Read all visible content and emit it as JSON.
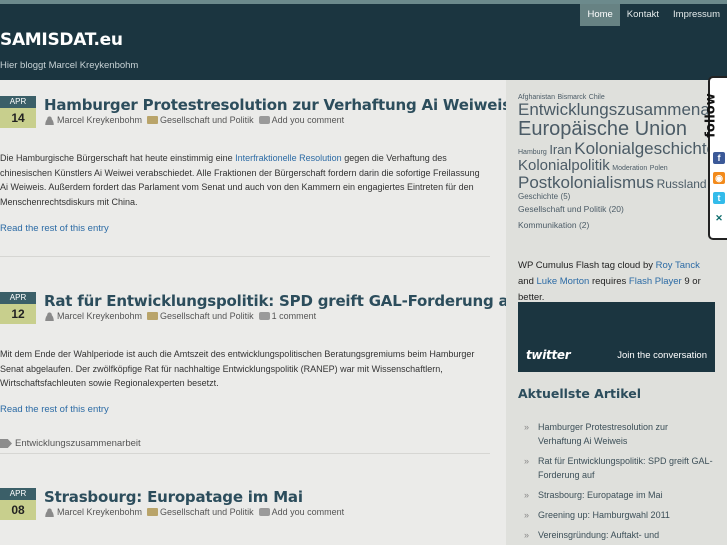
{
  "header": {
    "site_title": "SAMISDAT.eu",
    "site_description": "Hier bloggt Marcel Kreykenbohm",
    "nav": [
      {
        "label": "Home",
        "active": true
      },
      {
        "label": "Kontakt",
        "active": false
      },
      {
        "label": "Impressum",
        "active": false
      }
    ]
  },
  "posts": [
    {
      "month": "Apr",
      "day": "14",
      "title": "Hamburger Protestresolution zur Verhaftung Ai Weiweis",
      "author": "Marcel Kreykenbohm",
      "category": "Gesellschaft und Politik",
      "comments": "Add you comment",
      "excerpt_before": "Die Hamburgische Bürgerschaft hat heute einstimmig eine ",
      "excerpt_link": "Interfraktionelle Resolution",
      "excerpt_after": " gegen die Verhaftung des chinesischen Künstlers Ai Weiwei verabschiedet. Alle Fraktionen der Bürgerschaft fordern darin die sofortige Freilassung Ai Weiweis. Außerdem fordert das Parlament vom Senat und auch von den Kammern ein engagiertes Eintreten für den Menschenrechtsdiskurs mit China.",
      "more": "Read the rest of this entry",
      "tags": ""
    },
    {
      "month": "Apr",
      "day": "12",
      "title": "Rat für Entwicklungspolitik: SPD greift GAL-Forderung auf",
      "author": "Marcel Kreykenbohm",
      "category": "Gesellschaft und Politik",
      "comments": "1 comment",
      "excerpt_before": "Mit dem Ende der Wahlperiode ist auch die Amtszeit des entwicklungspolitischen Beratungsgremiums beim Hamburger Senat abgelaufen. Der zwölfköpfige Rat für nachhaltige Entwicklungspolitik (RANEP) war mit Wissenschaftlern, Wirtschaftsfachleuten sowie Regionalexperten besetzt.",
      "excerpt_link": "",
      "excerpt_after": "",
      "more": "Read the rest of this entry",
      "tags": "Entwicklungszusammenarbeit"
    },
    {
      "month": "Apr",
      "day": "08",
      "title": "Strasbourg: Europatage im Mai",
      "author": "Marcel Kreykenbohm",
      "category": "Gesellschaft und Politik",
      "comments": "Add you comment"
    }
  ],
  "sidebar": {
    "tag_cloud": [
      {
        "label": "Afghanistan",
        "size": 7
      },
      {
        "label": "Bismarck",
        "size": 7
      },
      {
        "label": "Chile",
        "size": 7
      },
      {
        "label": "Entwicklungszusammenarbeit",
        "size": 17
      },
      {
        "label": "Europäische Union",
        "size": 20
      },
      {
        "label": "Hamburg",
        "size": 7
      },
      {
        "label": "Iran",
        "size": 13
      },
      {
        "label": "Kolonialgeschichte",
        "size": 17
      },
      {
        "label": "Kolonialpolitik",
        "size": 15
      },
      {
        "label": "Moderation",
        "size": 7
      },
      {
        "label": "Polen",
        "size": 7
      },
      {
        "label": "Postkolonialismus",
        "size": 17
      },
      {
        "label": "Russland",
        "size": 12
      },
      {
        "label": "Geschichte",
        "size": 8
      }
    ],
    "categories": [
      {
        "label": "Geschichte",
        "count": "(5)"
      },
      {
        "label": "Gesellschaft und Politik",
        "count": "(20)"
      },
      {
        "label": "Kommunikation",
        "count": "(2)"
      }
    ],
    "cumulus": {
      "prefix": "WP Cumulus Flash tag cloud by ",
      "author1": "Roy Tanck",
      "and": " and ",
      "author2": "Luke Morton",
      "requires": " requires ",
      "flash": "Flash Player",
      "suffix": " 9 or better."
    },
    "twitter": {
      "logo": "twitter",
      "join": "Join the conversation"
    },
    "recent_title": "Aktuellste Artikel",
    "recent_posts": [
      "Hamburger Protestresolution zur Verhaftung Ai Weiweis",
      "Rat für Entwicklungspolitik: SPD greift GAL-Forderung auf",
      "Strasbourg: Europatage im Mai",
      "Greening up: Hamburgwahl 2011",
      "Vereinsgründung: Auftakt- und"
    ]
  },
  "follow": {
    "label": "follow",
    "icons": [
      "facebook-icon",
      "rss-icon",
      "twitter-icon",
      "xing-icon"
    ]
  },
  "colors": {
    "header_bg": "#1b3540",
    "nav_active": "#678283",
    "title": "#2c4d5c",
    "link": "#2c6ba5",
    "date_month_bg": "#3b5f68",
    "date_day_bg": "#c8cf8d"
  }
}
